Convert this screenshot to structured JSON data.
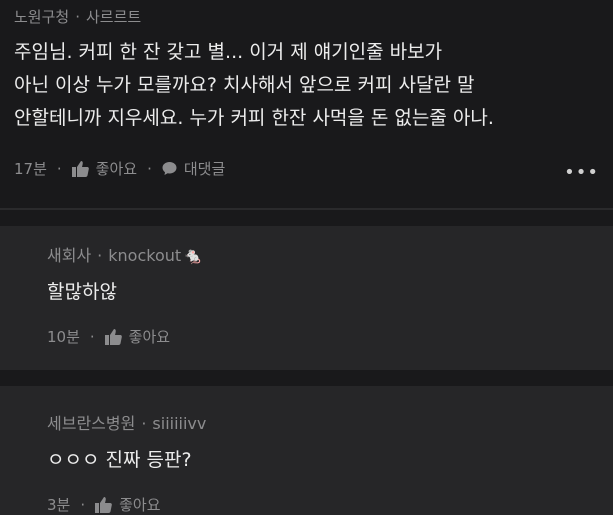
{
  "comments": [
    {
      "author": "노원구청",
      "badge": "사르르트",
      "lines": [
        "주임님. 커피 한 잔 갖고 별... 이거 제 얘기인줄 바보가",
        "아닌 이상 누가 모를까요? 치사해서 앞으로 커피 사달란 말",
        "안할테니까 지우세요. 누가 커피 한잔 사먹을 돈 없는줄 아나."
      ],
      "time": "17분",
      "like_label": "좋아요",
      "reply_label": "대댓글",
      "more": "•••"
    },
    {
      "author": "새회사",
      "badge": "knockout",
      "badge_emoji": "🐁",
      "text": "할많하않",
      "time": "10분",
      "like_label": "좋아요"
    },
    {
      "author": "세브란스병원",
      "badge": "siiiiiivv",
      "text": "ㅇㅇㅇ 진짜 등판?",
      "time": "3분",
      "like_label": "좋아요"
    }
  ]
}
